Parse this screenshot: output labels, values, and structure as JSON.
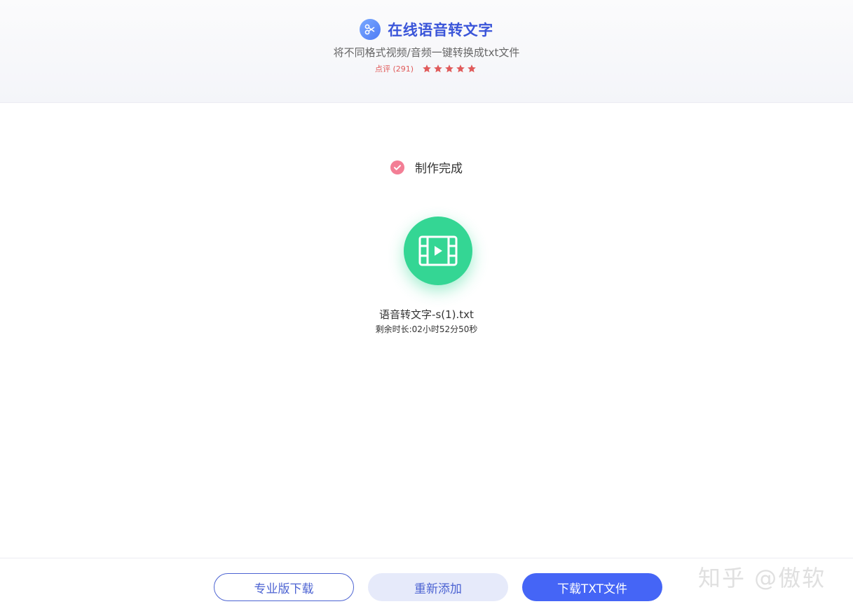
{
  "header": {
    "app_title": "在线语音转文字",
    "subtitle": "将不同格式视频/音频一键转换成txt文件",
    "rating_label": "点评 (291)",
    "stars": 5,
    "star_color": "#e05a5a",
    "logo_icon": "scissors-icon"
  },
  "status": {
    "text": "制作完成",
    "icon": "check-icon",
    "icon_color": "#f37e95"
  },
  "file": {
    "icon": "video-icon",
    "icon_color": "#34d694",
    "name": "语音转文字-s(1).txt",
    "remaining": "剩余时长:02小时52分50秒"
  },
  "footer": {
    "pro_download_label": "专业版下载",
    "readd_label": "重新添加",
    "download_txt_label": "下载TXT文件",
    "primary_color": "#4565f6"
  },
  "watermark": "知乎 @傲软"
}
